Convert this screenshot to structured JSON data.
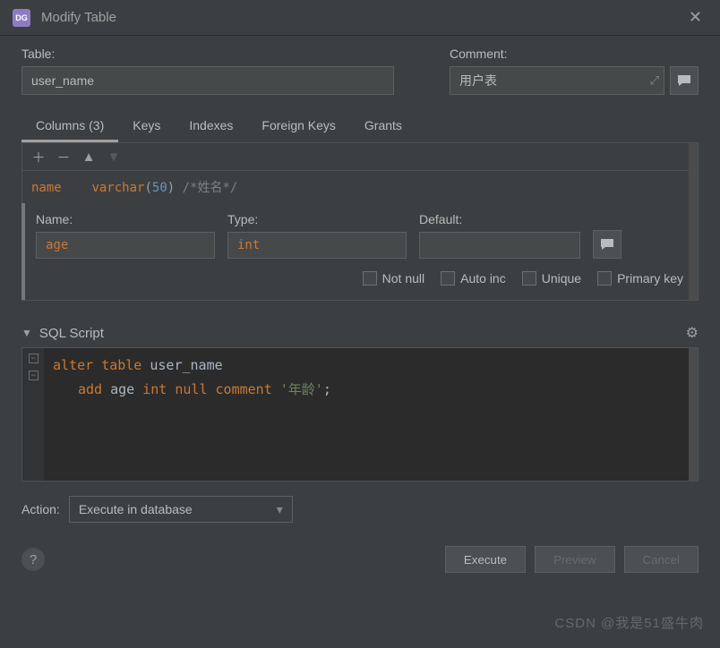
{
  "window": {
    "title": "Modify Table"
  },
  "labels": {
    "table": "Table:",
    "comment": "Comment:",
    "name": "Name:",
    "type": "Type:",
    "default": "Default:",
    "action": "Action:",
    "sql_script": "SQL Script"
  },
  "fields": {
    "table": "user_name",
    "comment": "用户表",
    "col_name": "age",
    "col_type": "int",
    "col_default": ""
  },
  "tabs": {
    "columns": "Columns (3)",
    "keys": "Keys",
    "indexes": "Indexes",
    "foreign_keys": "Foreign Keys",
    "grants": "Grants"
  },
  "column_preview": {
    "name": "name",
    "type_kw": "varchar",
    "type_open": "(",
    "type_num": "50",
    "type_close": ")",
    "comment": "/*姓名*/"
  },
  "checkboxes": {
    "not_null": "Not null",
    "auto_inc": "Auto inc",
    "unique": "Unique",
    "primary_key": "Primary key"
  },
  "sql": {
    "l1_kw1": "alter",
    "l1_kw2": "table",
    "l1_ident": "user_name",
    "l2_kw1": "add",
    "l2_ident": "age",
    "l2_type": "int",
    "l2_kw2": "null",
    "l2_kw3": "comment",
    "l2_str": "'年龄'",
    "l2_term": ";"
  },
  "action_select": "Execute in database",
  "buttons": {
    "execute": "Execute",
    "preview": "Preview",
    "cancel": "Cancel"
  },
  "watermark": "CSDN @我是51盛牛肉"
}
